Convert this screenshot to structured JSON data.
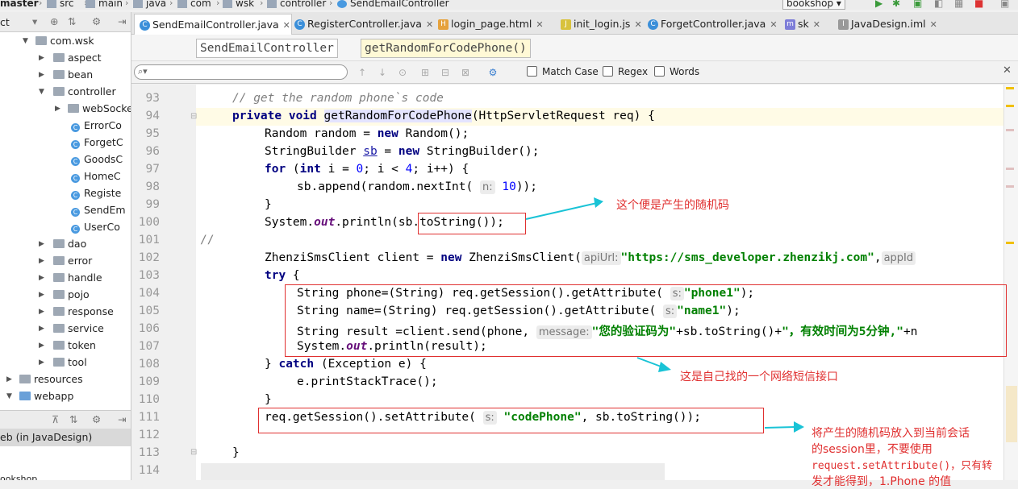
{
  "nav": {
    "crumbs": [
      "master",
      "src",
      "main",
      "java",
      "com",
      "wsk",
      "controller",
      "SendEmailController"
    ],
    "project": "bookshop"
  },
  "tabs": [
    {
      "label": "SendEmailController.java",
      "icon": "C",
      "active": true
    },
    {
      "label": "RegisterController.java",
      "icon": "C",
      "active": false
    },
    {
      "label": "login_page.html",
      "icon": "html-file-icon",
      "active": false
    },
    {
      "label": "init_login.js",
      "icon": "js-file-icon",
      "active": false
    },
    {
      "label": "ForgetController.java",
      "icon": "C",
      "active": false
    },
    {
      "label": "sk",
      "icon": "m",
      "active": false
    },
    {
      "label": "JavaDesign.iml",
      "icon": "iml-file-icon",
      "active": false
    }
  ],
  "breadcrumb": {
    "class_name": "SendEmailController",
    "method_name": "getRandomForCodePhone()"
  },
  "search": {
    "placeholder": "",
    "match_case": "Match Case",
    "regex": "Regex",
    "words": "Words"
  },
  "sidebar": {
    "items": [
      {
        "label": "ct",
        "kind": "text"
      },
      {
        "label": "com.wsk",
        "kind": "folder"
      },
      {
        "label": "aspect",
        "kind": "folder"
      },
      {
        "label": "bean",
        "kind": "folder"
      },
      {
        "label": "controller",
        "kind": "folder"
      },
      {
        "label": "webSocke",
        "kind": "folder"
      },
      {
        "label": "ErrorCo",
        "kind": "class"
      },
      {
        "label": "ForgetC",
        "kind": "class"
      },
      {
        "label": "GoodsC",
        "kind": "class"
      },
      {
        "label": "HomeC",
        "kind": "class"
      },
      {
        "label": "Registe",
        "kind": "class"
      },
      {
        "label": "SendEm",
        "kind": "class"
      },
      {
        "label": "UserCo",
        "kind": "class"
      },
      {
        "label": "dao",
        "kind": "folder"
      },
      {
        "label": "error",
        "kind": "folder"
      },
      {
        "label": "handle",
        "kind": "folder"
      },
      {
        "label": "pojo",
        "kind": "folder"
      },
      {
        "label": "response",
        "kind": "folder"
      },
      {
        "label": "service",
        "kind": "folder"
      },
      {
        "label": "token",
        "kind": "folder"
      },
      {
        "label": "tool",
        "kind": "folder"
      },
      {
        "label": "resources",
        "kind": "folder"
      },
      {
        "label": "webapp",
        "kind": "folder"
      }
    ],
    "bottom_label": "eb (in JavaDesign)",
    "footer": "ookshop"
  },
  "code": {
    "line_numbers": [
      "93",
      "94",
      "95",
      "96",
      "97",
      "98",
      "99",
      "100",
      "101",
      "102",
      "103",
      "104",
      "105",
      "106",
      "107",
      "108",
      "109",
      "110",
      "111",
      "112",
      "113",
      "114"
    ],
    "comment_93": "// get the random phone`s code",
    "kw_private_void": "private void",
    "method_name": "getRandomForCodePhone",
    "params_94": "(HttpServletRequest req) {",
    "l95": "Random random = ",
    "kw_new": "new",
    "l95b": " Random();",
    "l96a": "StringBuilder ",
    "l96_var": "sb",
    "l96b": " = ",
    "l96c": " StringBuilder();",
    "kw_for": "for",
    "l97a": " (",
    "kw_int": "int",
    "l97b": " i = ",
    "num_0": "0",
    "l97c": "; i < ",
    "num_4": "4",
    "l97d": "; i++) {",
    "l98a": "sb.append(random.nextInt(",
    "hint_n": "n:",
    "num_10": "10",
    "l98b": "));",
    "brace_close": "}",
    "l100a": "System.",
    "static_out": "out",
    "l100b": ".println(sb.toString());",
    "l101": "//",
    "l102a": "ZhenziSmsClient client = ",
    "l102b": " ZhenziSmsClient(",
    "hint_apiurl": "apiUrl:",
    "str_url": "\"https://sms_developer.zhenzikj.com\"",
    "l102c": ",",
    "hint_appid": "appId",
    "kw_try": "try",
    "l103b": " {",
    "l104a": "String phone=(String) req.getSession().getAttribute(",
    "hint_s": "s:",
    "str_phone1": "\"phone1\"",
    "l104b": ");",
    "l105a": "String name=(String) req.getSession().getAttribute(",
    "str_name1": "\"name1\"",
    "l106a": "String result =client.send(phone,",
    "hint_message": "message:",
    "str_msg": "\"您的验证码为\"",
    "l106b": "+sb.toString()+",
    "str_msg2": "\"，有效时间为5分钟,\"",
    "l106c": "+n",
    "l107b": ".println(result);",
    "l108a": "} ",
    "kw_catch": "catch",
    "l108b": " (Exception e) {",
    "l109": "e.printStackTrace();",
    "l111a": "req.getSession().setAttribute(",
    "str_codephone": "\"codePhone\"",
    "l111b": ", sb.toString());"
  },
  "annotations": {
    "note1": "这个便是产生的随机码",
    "note2": "这是自己找的一个网络短信接口",
    "note3_line1": "将产生的随机码放入到当前会话",
    "note3_line2": "的session里，不要使用",
    "note3_line3": "request.setAttribute()，只有转",
    "note3_line4": "发才能得到，1.Phone 的值"
  },
  "colors": {
    "annotation": "#e03030",
    "keyword": "#000080",
    "string": "#008000",
    "arrow": "#19c3d6"
  }
}
